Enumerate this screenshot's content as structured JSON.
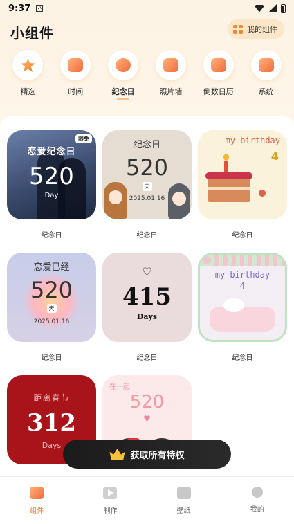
{
  "status_bar": {
    "time": "9:37",
    "notification_icon": "A"
  },
  "header": {
    "title": "小组件",
    "my_widgets_label": "我的组件"
  },
  "categories": [
    {
      "label": "精选",
      "icon": "star-icon"
    },
    {
      "label": "时间",
      "icon": "clock-icon"
    },
    {
      "label": "纪念日",
      "icon": "anniversary-icon",
      "active": true
    },
    {
      "label": "照片墙",
      "icon": "photo-wall-icon"
    },
    {
      "label": "倒数日历",
      "icon": "calendar-icon"
    },
    {
      "label": "系统",
      "icon": "system-icon"
    }
  ],
  "widgets": [
    {
      "caption": "纪念日",
      "title": "恋爱纪念日",
      "number": "520",
      "unit": "Day",
      "badge": "限免"
    },
    {
      "caption": "纪念日",
      "title": "纪念日",
      "number": "520",
      "unit": "天",
      "date": "2025.01.16"
    },
    {
      "caption": "纪念日",
      "title": "my birthday",
      "number": "4"
    },
    {
      "caption": "纪念日",
      "title": "恋爱已经",
      "number": "520",
      "unit": "天",
      "date": "2025.01.16"
    },
    {
      "caption": "纪念日",
      "heart": "♡",
      "number": "415",
      "unit": "Days"
    },
    {
      "caption": "纪念日",
      "title": "my birthday",
      "number": "4"
    },
    {
      "title": "距离春节",
      "number": "312",
      "unit": "Days"
    },
    {
      "title": "在一起",
      "number": "520",
      "heart": "♥"
    }
  ],
  "privilege_button": {
    "label": "获取所有特权"
  },
  "bottom_nav": [
    {
      "label": "组件",
      "icon": "widgets-icon",
      "active": true
    },
    {
      "label": "制作",
      "icon": "play-icon"
    },
    {
      "label": "壁纸",
      "icon": "wallpaper-icon"
    },
    {
      "label": "我的",
      "icon": "profile-icon"
    }
  ],
  "colors": {
    "accent": "#ee7a2e",
    "header_bg": "#fdf3e4"
  }
}
